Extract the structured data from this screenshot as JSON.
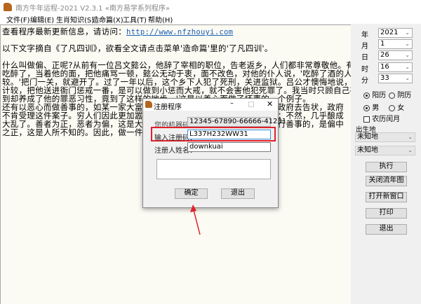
{
  "window": {
    "title": "南方牛年运程-2021  V2.3.1  «南方易学系列程序»",
    "icon": "app-horse-icon"
  },
  "menu": [
    "文件(F)",
    "编辑(E)",
    "生肖知识(S)",
    "造命篇(X)",
    "工具(T)",
    "帮助(H)"
  ],
  "content": {
    "update_prefix": "查看程序最新更新信息，请访问：",
    "update_link": "http://www.nfzhouyi.com",
    "intro": "以下文字摘自《了凡四训》，欲看全文请点击菜单'造命篇'里的'了凡四训'。",
    "lines": [
      "什么叫做偏、正呢?从前有一位吕文懿公，他辞了宰相的职位，告老返乡，人们都非常尊敬他。有一次，有个乡下人",
      "吃醉了，当着他的面，把他痛骂一顿，懿公无动于衷，面不改色，对他的仆人说，'吃醉了酒的人，不必与他计",
      "较。'把门一关，就避开了。过了一年以后，这个乡下人犯了死刑，关进监狱。吕公才懊悔地说，'假使我当时稍与",
      "计较，把他送进衙门惩戒一番，是可以做到小惩而大戒，就不会害他犯死罪了。我当时只顾自己存心于厚道，想不",
      "到却养成了他的罪恶习性，竟到了这样的地步。'这是以善心而做了坏事的一个例子。"
    ],
    "split_lines": [
      {
        "left": "还有以恶心而做善事的，如某一家大富户，有一",
        "right": "也向政府去告状，政府"
      },
      {
        "left": "不肯受理这件案子。穷人们因此更加嚣张。他就",
        "right": "不来；不然，几乎酿成"
      },
      {
        "left": "大乱了。善者为正，恶者为偏，这是大家都知道",
        "right": "心而行善事的，是偏中"
      },
      {
        "left": "之正，这是人所不知的。因此，做一件事，应措",
        "right": ""
      }
    ]
  },
  "side": {
    "fields": [
      {
        "label": "年",
        "value": "2021"
      },
      {
        "label": "月",
        "value": "1"
      },
      {
        "label": "日",
        "value": "26"
      },
      {
        "label": "时",
        "value": "16"
      },
      {
        "label": "分",
        "value": "33"
      }
    ],
    "calendar": {
      "options": [
        "阳历",
        "阴历"
      ],
      "selected": "阳历"
    },
    "gender": {
      "options": [
        "男",
        "女"
      ],
      "selected": "男"
    },
    "leap_month": {
      "label": "农历闰月",
      "checked": false
    },
    "birthplace_label": "出生地",
    "birthplace": [
      "未知地",
      "未知地"
    ],
    "buttons": [
      "执行",
      "关闭流年图",
      "打开新窗口",
      "打印",
      "退出"
    ]
  },
  "dialog": {
    "title": "注册程序",
    "machine_label": "您的机器码：",
    "machine_value": "12345-67890-66666-41231",
    "code_label": "输入注册码：",
    "code_value": "L337H232WW31",
    "name_label": "注册人姓名：",
    "name_value": "downkuai",
    "message": "",
    "ok": "确定",
    "cancel": "退出"
  },
  "annotation": {
    "highlight_color": "#e0202a",
    "arrow_color": "#e0202a"
  }
}
